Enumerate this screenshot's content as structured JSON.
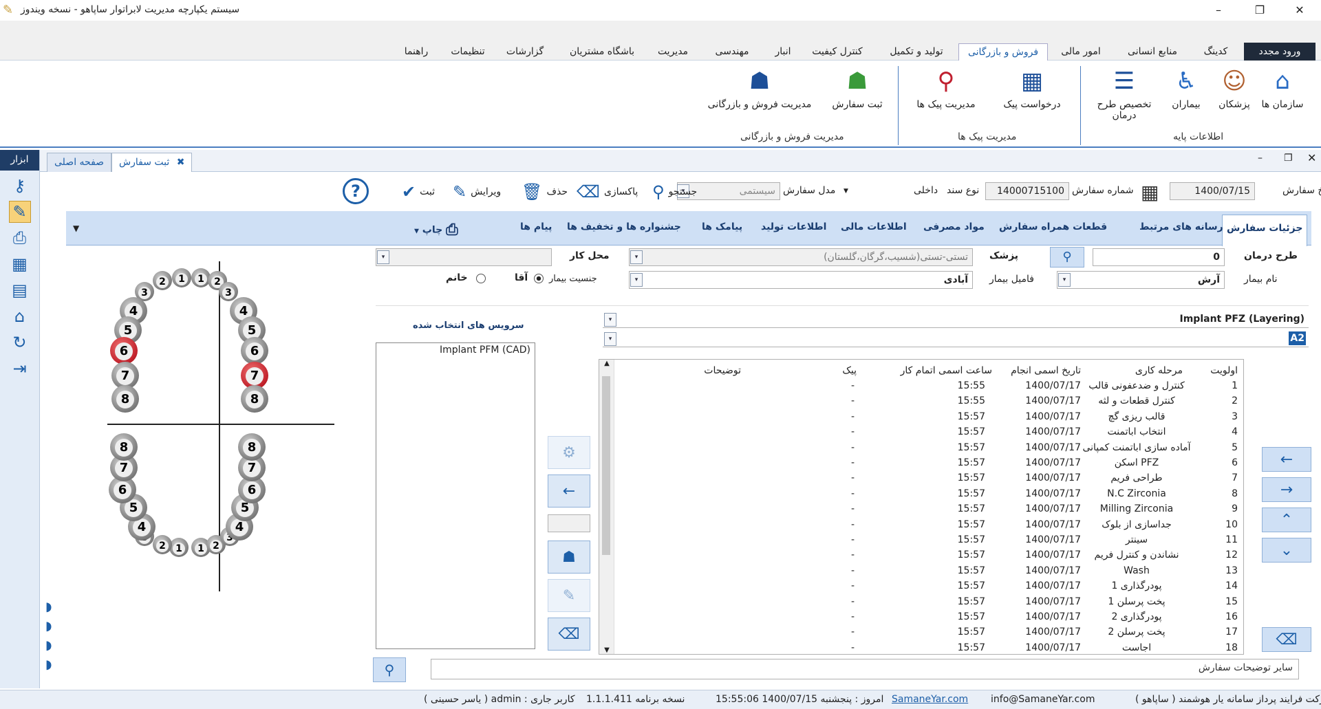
{
  "window": {
    "title": "سیستم یکپارچه مدیریت لابراتوار ساپاهو - نسخه ویندوز",
    "minimize": "–",
    "maximize": "❐",
    "close": "✕"
  },
  "ribbon_tabs": [
    "راهنما",
    "تنظیمات",
    "گزارشات",
    "باشگاه مشتریان",
    "مدیریت",
    "مهندسی",
    "انبار",
    "کنترل کیفیت",
    "تولید و تکمیل",
    "فروش و بازرگانی",
    "امور مالی",
    "منابع انسانی",
    "کدینگ"
  ],
  "relogin": "ورود مجدد",
  "ribbon": {
    "buttons": [
      {
        "label": "سازمان ها",
        "icon": "building-icon"
      },
      {
        "label": "پزشکان",
        "icon": "doctor-icon"
      },
      {
        "label": "بیماران",
        "icon": "patient-icon"
      },
      {
        "label": "تخصیص طرح درمان",
        "icon": "list-icon"
      },
      {
        "label": "درخواست پیک",
        "icon": "courier-request-icon"
      },
      {
        "label": "مدیریت پیک ها",
        "icon": "courier-manage-icon"
      },
      {
        "label": "ثبت سفارش",
        "icon": "tooth-order-icon"
      },
      {
        "label": "مدیریت فروش و بازرگانی",
        "icon": "tooth-search-icon"
      }
    ],
    "groups": [
      "اطلاعات پایه",
      "مدیریت پیک ها",
      "مدیریت فروش و بازرگانی"
    ]
  },
  "tools_header": "ابزار",
  "doc_tabs": {
    "active": "ثبت سفارش",
    "home": "صفحه اصلی",
    "close": "✖"
  },
  "order": {
    "date_label": "تاریخ سفارش",
    "date": "1400/07/15",
    "number_label": "شماره سفارش",
    "number": "14000715100",
    "doc_type_label": "نوع سند",
    "doc_type": "داخلی",
    "model_label": "مدل سفارش",
    "model": "سیستمی"
  },
  "toolbar": {
    "save": "ثبت",
    "edit": "ویرایش",
    "delete": "حذف",
    "clear": "پاکسازی",
    "search": "جستجو",
    "help": "?"
  },
  "subtabs": [
    "جزئیات سفارش",
    "رسانه های مرتبط",
    "قطعات همراه سفارش",
    "مواد مصرفی",
    "اطلاعات مالی",
    "اطلاعات تولید",
    "پیامک ها",
    "جشنواره ها و تخفیف ها",
    "پیام ها",
    "چاپ"
  ],
  "form": {
    "plan_label": "طرح درمان",
    "plan_value": "0",
    "doctor_label": "پزشک",
    "doctor_value": "تستی-تستی(شسیب،گرگان،گلستان)",
    "workplace_label": "محل کار",
    "workplace_value": "",
    "patient_name_label": "نام بیمار",
    "patient_name": "آرش",
    "patient_family_label": "فامیل بیمار",
    "patient_family": "آبادی",
    "gender_label": "جنسیت بیمار",
    "gender_male": "آقا",
    "gender_female": "خانم"
  },
  "service": {
    "name": "Implant PFZ (Layering)",
    "shade": "A2"
  },
  "selected_services_label": "سرویس های انتخاب شده",
  "selected_services": [
    "Implant PFM (CAD)"
  ],
  "grid": {
    "headers": [
      "اولویت",
      "مرحله کاری",
      "تاریخ اسمی انجام",
      "ساعت اسمی اتمام کار",
      "پیک",
      "توضیحات"
    ],
    "rows": [
      [
        "1",
        "کنترل و ضدعفونی قالب",
        "1400/07/17",
        "15:55",
        "-"
      ],
      [
        "2",
        "کنترل قطعات و لثه",
        "1400/07/17",
        "15:55",
        "-"
      ],
      [
        "3",
        "قالب ریزی گچ",
        "1400/07/17",
        "15:57",
        "-"
      ],
      [
        "4",
        "انتخاب اباتمنت",
        "1400/07/17",
        "15:57",
        "-"
      ],
      [
        "5",
        "آماده سازی اباتمنت کمپانی",
        "1400/07/17",
        "15:57",
        "-"
      ],
      [
        "6",
        "اسکن PFZ",
        "1400/07/17",
        "15:57",
        "-"
      ],
      [
        "7",
        "طراحی فریم",
        "1400/07/17",
        "15:57",
        "-"
      ],
      [
        "8",
        "N.C Zirconia",
        "1400/07/17",
        "15:57",
        "-"
      ],
      [
        "9",
        "Milling Zirconia",
        "1400/07/17",
        "15:57",
        "-"
      ],
      [
        "10",
        "جداسازی از بلوک",
        "1400/07/17",
        "15:57",
        "-"
      ],
      [
        "11",
        "سینتر",
        "1400/07/17",
        "15:57",
        "-"
      ],
      [
        "12",
        "نشاندن و کنترل فریم",
        "1400/07/17",
        "15:57",
        "-"
      ],
      [
        "13",
        "Wash",
        "1400/07/17",
        "15:57",
        "-"
      ],
      [
        "14",
        "پودرگذاری 1",
        "1400/07/17",
        "15:57",
        "-"
      ],
      [
        "15",
        "پخت پرسلن 1",
        "1400/07/17",
        "15:57",
        "-"
      ],
      [
        "16",
        "پودرگذاری 2",
        "1400/07/17",
        "15:57",
        "-"
      ],
      [
        "17",
        "پخت پرسلن 2",
        "1400/07/17",
        "15:57",
        "-"
      ],
      [
        "18",
        "اجاست",
        "1400/07/17",
        "15:57",
        "-"
      ]
    ]
  },
  "other_notes_placeholder": "سایر توضیحات سفارش",
  "teeth": {
    "upper_right": [
      "1",
      "2",
      "3",
      "4",
      "5",
      "6",
      "7",
      "8"
    ],
    "upper_left": [
      "1",
      "2",
      "3",
      "4",
      "5",
      "6",
      "7",
      "8"
    ],
    "lower_right": [
      "1",
      "2",
      "3",
      "4",
      "5",
      "6",
      "7",
      "8"
    ],
    "lower_left": [
      "1",
      "2",
      "3",
      "4",
      "5",
      "6",
      "7",
      "8"
    ],
    "selected": [
      "upper-right-6",
      "upper-left-7"
    ]
  },
  "status": {
    "company": "شرکت فرایند پرداز سامانه یار هوشمند ( ساپاهو )",
    "email": "info@SamaneYar.com",
    "site": "SamaneYar.com",
    "today": "امروز : پنجشنبه  1400/07/15   15:55:06",
    "version": "نسخه برنامه   1.1.1.411",
    "user": "کاربر جاری :  admin   ( یاسر حسینی )"
  }
}
